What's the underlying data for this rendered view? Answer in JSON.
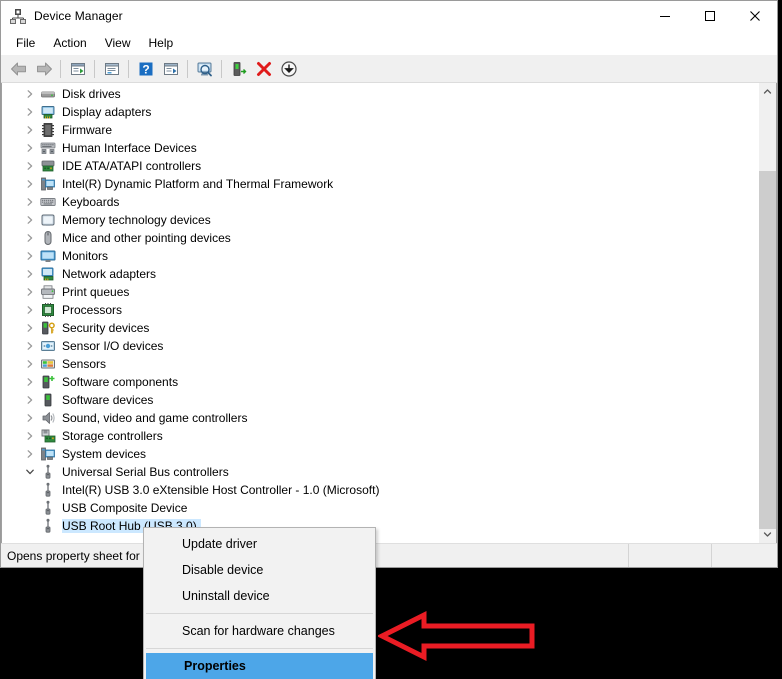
{
  "window": {
    "title": "Device Manager",
    "icon": "device-manager-icon",
    "caption_buttons": [
      {
        "name": "minimize",
        "glyph": "minimize-icon"
      },
      {
        "name": "maximize",
        "glyph": "maximize-icon"
      },
      {
        "name": "close",
        "glyph": "close-icon"
      }
    ]
  },
  "menubar": {
    "items": [
      {
        "label": "File"
      },
      {
        "label": "Action"
      },
      {
        "label": "View"
      },
      {
        "label": "Help"
      }
    ]
  },
  "toolbar": {
    "buttons": [
      {
        "name": "back-button",
        "icon": "back-arrow-icon"
      },
      {
        "name": "forward-button",
        "icon": "forward-arrow-icon"
      },
      {
        "name": "show-hide-console-tree-button",
        "icon": "console-tree-icon"
      },
      {
        "name": "properties-button",
        "icon": "properties-window-icon"
      },
      {
        "name": "help-button",
        "icon": "help-question-icon"
      },
      {
        "name": "update-driver-button",
        "icon": "update-driver-icon"
      },
      {
        "name": "scan-hardware-changes-button",
        "icon": "scan-monitor-icon"
      },
      {
        "name": "enable-device-button",
        "icon": "enable-device-icon"
      },
      {
        "name": "uninstall-device-button",
        "icon": "uninstall-red-x-icon"
      },
      {
        "name": "disable-device-button",
        "icon": "disable-down-arrow-icon"
      }
    ]
  },
  "tree": {
    "nodes": [
      {
        "label": "Disk drives",
        "icon": "disk-drive-icon",
        "level": 0,
        "expanded": false,
        "selected": false
      },
      {
        "label": "Display adapters",
        "icon": "display-adapter-icon",
        "level": 0,
        "expanded": false,
        "selected": false
      },
      {
        "label": "Firmware",
        "icon": "firmware-chip-icon",
        "level": 0,
        "expanded": false,
        "selected": false
      },
      {
        "label": "Human Interface Devices",
        "icon": "hid-icon",
        "level": 0,
        "expanded": false,
        "selected": false
      },
      {
        "label": "IDE ATA/ATAPI controllers",
        "icon": "ide-controller-icon",
        "level": 0,
        "expanded": false,
        "selected": false
      },
      {
        "label": "Intel(R) Dynamic Platform and Thermal Framework",
        "icon": "system-device-icon",
        "level": 0,
        "expanded": false,
        "selected": false
      },
      {
        "label": "Keyboards",
        "icon": "keyboard-icon",
        "level": 0,
        "expanded": false,
        "selected": false
      },
      {
        "label": "Memory technology devices",
        "icon": "memory-device-icon",
        "level": 0,
        "expanded": false,
        "selected": false
      },
      {
        "label": "Mice and other pointing devices",
        "icon": "mouse-icon",
        "level": 0,
        "expanded": false,
        "selected": false
      },
      {
        "label": "Monitors",
        "icon": "monitor-icon",
        "level": 0,
        "expanded": false,
        "selected": false
      },
      {
        "label": "Network adapters",
        "icon": "network-adapter-icon",
        "level": 0,
        "expanded": false,
        "selected": false
      },
      {
        "label": "Print queues",
        "icon": "printer-icon",
        "level": 0,
        "expanded": false,
        "selected": false
      },
      {
        "label": "Processors",
        "icon": "processor-icon",
        "level": 0,
        "expanded": false,
        "selected": false
      },
      {
        "label": "Security devices",
        "icon": "security-key-icon",
        "level": 0,
        "expanded": false,
        "selected": false
      },
      {
        "label": "Sensor I/O devices",
        "icon": "sensor-io-icon",
        "level": 0,
        "expanded": false,
        "selected": false
      },
      {
        "label": "Sensors",
        "icon": "sensors-icon",
        "level": 0,
        "expanded": false,
        "selected": false
      },
      {
        "label": "Software components",
        "icon": "software-component-icon",
        "level": 0,
        "expanded": false,
        "selected": false
      },
      {
        "label": "Software devices",
        "icon": "software-device-icon",
        "level": 0,
        "expanded": false,
        "selected": false
      },
      {
        "label": "Sound, video and game controllers",
        "icon": "speaker-icon",
        "level": 0,
        "expanded": false,
        "selected": false
      },
      {
        "label": "Storage controllers",
        "icon": "storage-controller-icon",
        "level": 0,
        "expanded": false,
        "selected": false
      },
      {
        "label": "System devices",
        "icon": "system-device-icon",
        "level": 0,
        "expanded": false,
        "selected": false
      },
      {
        "label": "Universal Serial Bus controllers",
        "icon": "usb-icon",
        "level": 0,
        "expanded": true,
        "selected": false
      },
      {
        "label": "Intel(R) USB 3.0 eXtensible Host Controller - 1.0 (Microsoft)",
        "icon": "usb-icon",
        "level": 1,
        "expanded": null,
        "selected": false
      },
      {
        "label": "USB Composite Device",
        "icon": "usb-icon",
        "level": 1,
        "expanded": null,
        "selected": false
      },
      {
        "label": "USB Root Hub (USB 3.0)",
        "icon": "usb-icon",
        "level": 1,
        "expanded": null,
        "selected": true
      }
    ]
  },
  "context_menu": {
    "items": [
      {
        "label": "Update driver",
        "highlighted": false,
        "separator_after": false
      },
      {
        "label": "Disable device",
        "highlighted": false,
        "separator_after": false
      },
      {
        "label": "Uninstall device",
        "highlighted": false,
        "separator_after": true
      },
      {
        "label": "Scan for hardware changes",
        "highlighted": false,
        "separator_after": true
      },
      {
        "label": "Properties",
        "highlighted": true,
        "separator_after": false
      }
    ]
  },
  "statusbar": {
    "text": "Opens property sheet for th"
  },
  "annotation": {
    "arrow_color": "#ea1c24",
    "direction": "left"
  },
  "colors": {
    "selection_blue": "#cce8ff",
    "menu_highlight_blue": "#4da6e8",
    "toolbar_bg": "#f0f0f0",
    "annotation_red": "#ea1c24"
  }
}
